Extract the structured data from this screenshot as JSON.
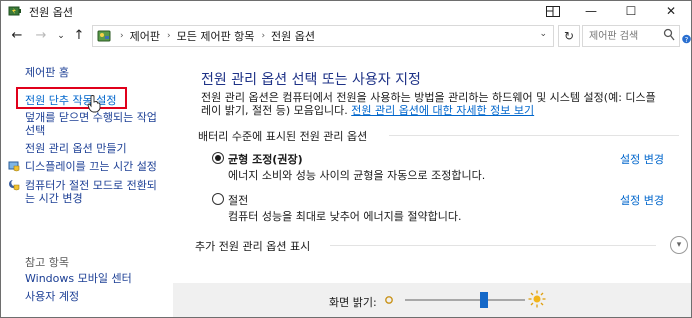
{
  "window": {
    "title": "전원 옵션",
    "minimize": "—",
    "maximize": "☐",
    "close": "✕"
  },
  "nav": {
    "back": "←",
    "forward": "→",
    "dropdown": "⌄",
    "up": "↑",
    "refresh": "↻"
  },
  "address": {
    "crumbs": [
      "제어판",
      "모든 제어판 항목",
      "전원 옵션"
    ],
    "separator": "›",
    "dropdown": "⌄"
  },
  "search": {
    "placeholder": "제어판 검색",
    "icon": "search-icon"
  },
  "sidebar": {
    "home": "제어판 홈",
    "items": [
      {
        "label": "전원 단추 작동 설정",
        "highlighted": true
      },
      {
        "label_line1": "덮개를 닫으면 수행되는 작업",
        "label_line2": "선택"
      },
      {
        "label": "전원 관리 옵션 만들기"
      },
      {
        "label": "디스플레이를 끄는 시간 설정",
        "icon": "display-shield-icon"
      },
      {
        "label_line1": "컴퓨터가 절전 모드로 전환되",
        "label_line2": "는 시간 변경",
        "icon": "moon-shield-icon"
      }
    ],
    "see_also": "참고 항목",
    "see_also_items": [
      "Windows 모바일 센터",
      "사용자 계정"
    ]
  },
  "main": {
    "title": "전원 관리 옵션 선택 또는 사용자 지정",
    "desc_line1": "전원 관리 옵션은 컴퓨터에서 전원을 사용하는 방법을 관리하는 하드웨어 및 시스템 설정(예: 디스플",
    "desc_line2": "레이 밝기, 절전 등) 모음입니다. ",
    "desc_link": "전원 관리 옵션에 대한 자세한 정보 보기",
    "battery_section": "배터리 수준에 표시된 전원 관리 옵션",
    "plans": [
      {
        "name": "균형 조정(권장)",
        "desc": "에너지 소비와 성능 사이의 균형을 자동으로 조정합니다.",
        "change": "설정 변경",
        "selected": true
      },
      {
        "name": "절전",
        "desc": "컴퓨터 성능을 최대로 낮추어 에너지를 절약합니다.",
        "change": "설정 변경",
        "selected": false
      }
    ],
    "more_plans": "추가 전원 관리 옵션 표시"
  },
  "brightness": {
    "label": "화면 밝기:",
    "level": 0.66
  },
  "colors": {
    "title_blue": "#1e3287",
    "link_blue": "#0066cc",
    "highlight_red": "#e0001b",
    "slider_blue": "#1468c8"
  }
}
